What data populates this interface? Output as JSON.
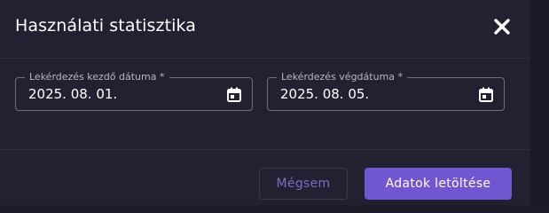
{
  "dialog": {
    "title": "Használati statisztika",
    "close_icon": "close-icon"
  },
  "fields": {
    "start": {
      "label": "Lekérdezés kezdő dátuma *",
      "value": "2025. 08. 01.",
      "icon": "calendar-icon"
    },
    "end": {
      "label": "Lekérdezés végdátuma *",
      "value": "2025. 08. 05.",
      "icon": "calendar-icon"
    }
  },
  "actions": {
    "cancel_label": "Mégsem",
    "download_label": "Adatok letöltése"
  },
  "colors": {
    "accent": "#7056d0",
    "background": "#222131",
    "text": "#ffffff"
  }
}
